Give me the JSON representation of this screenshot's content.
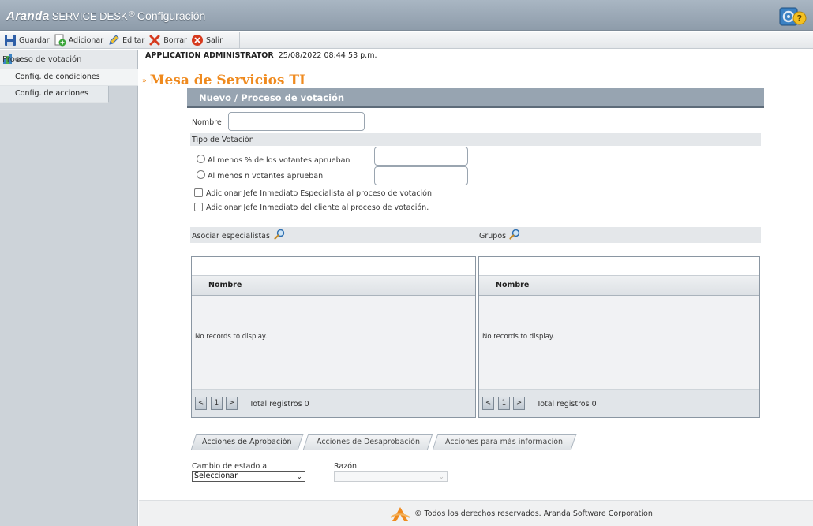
{
  "app": {
    "brand_name": "Aranda",
    "brand_product": "SERVICE DESK",
    "brand_mark": "®",
    "brand_section": "Configuración"
  },
  "toolbar": {
    "save_label": "Guardar",
    "add_label": "Adicionar",
    "edit_label": "Editar",
    "delete_label": "Borrar",
    "exit_label": "Salir"
  },
  "sidebar": {
    "header": "Proceso de votación",
    "items": [
      {
        "label": "Config. de condiciones"
      },
      {
        "label": "Config. de acciones"
      }
    ]
  },
  "session": {
    "user": "APPLICATION ADMINISTRATOR",
    "datetime": "25/08/2022 08:44:53 p.m."
  },
  "page": {
    "title": "Mesa de Servicios TI",
    "section_header": "Nuevo / Proceso de votación"
  },
  "form": {
    "name_label": "Nombre",
    "name_value": "",
    "vote_type_label": "Tipo de Votación",
    "radio_percent_label": "Al menos % de los votantes aprueban",
    "radio_count_label": "Al menos n votantes aprueban",
    "check_specialist_label": "Adicionar Jefe Inmediato Especialista al proceso de votación.",
    "check_client_label": "Adicionar Jefe Inmediato del cliente al proceso de votación.",
    "specialists_label": "Asociar especialistas",
    "groups_label": "Grupos"
  },
  "grids": {
    "specialists": {
      "column": "Nombre",
      "empty": "No records to display.",
      "page": "1",
      "total": "Total registros 0"
    },
    "groups": {
      "column": "Nombre",
      "empty": "No records to display.",
      "page": "1",
      "total": "Total registros 0"
    }
  },
  "tabs": [
    {
      "label": "Acciones de Aprobación",
      "active": true
    },
    {
      "label": "Acciones de Desaprobación",
      "active": false
    },
    {
      "label": "Acciones para más información",
      "active": false
    }
  ],
  "actions": {
    "state_change_label": "Cambio de estado a",
    "state_change_value": "Seleccionar",
    "reason_label": "Razón",
    "reason_value": ""
  },
  "footer": {
    "copyright": "© Todos los derechos reservados. Aranda Software Corporation"
  },
  "colors": {
    "accent_orange": "#ef8a1e",
    "header_bar": "#97a4b1",
    "sidebar_bg": "#cdd3d9"
  }
}
